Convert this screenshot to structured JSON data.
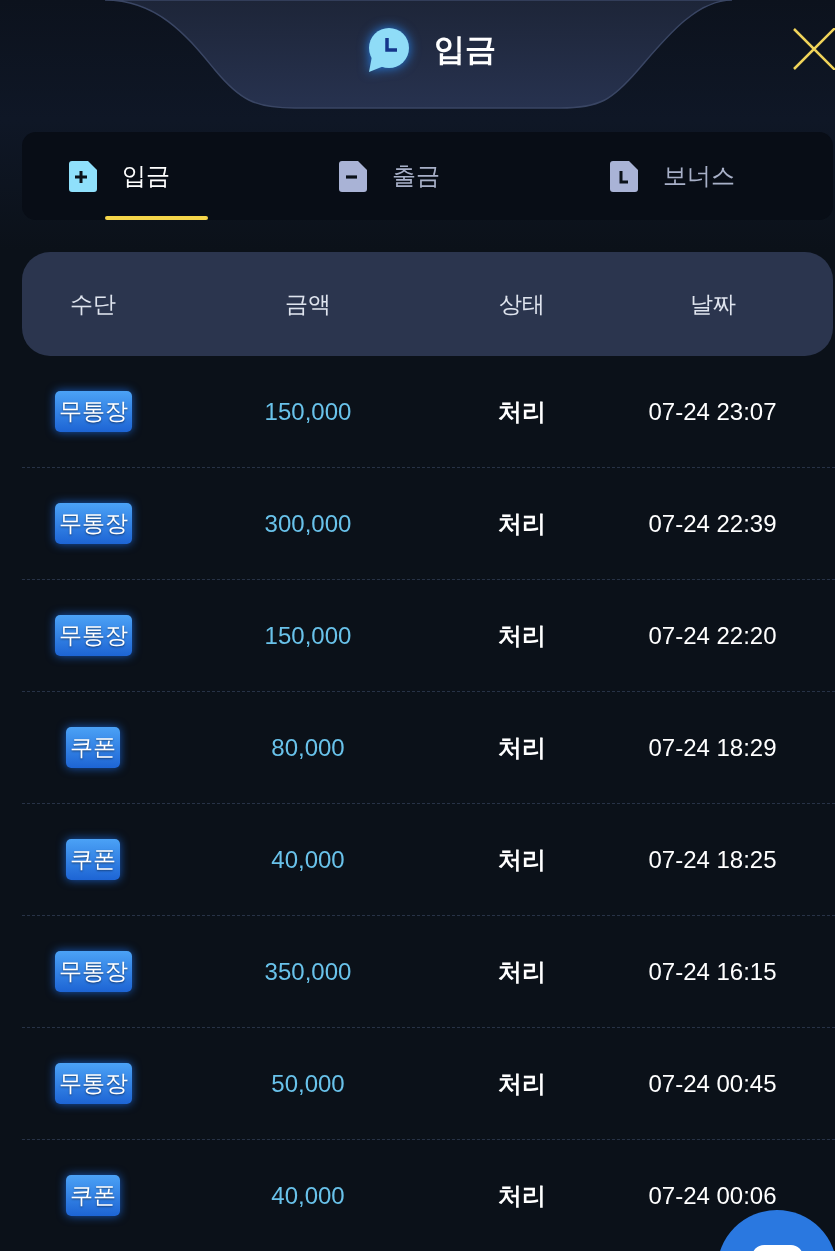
{
  "header": {
    "title": "입금"
  },
  "tabs": [
    {
      "label": "입금",
      "selected": true
    },
    {
      "label": "출금",
      "selected": false
    },
    {
      "label": "보너스",
      "selected": false
    }
  ],
  "table": {
    "columns": [
      "수단",
      "금액",
      "상태",
      "날짜"
    ],
    "rows": [
      {
        "method": "무통장",
        "amount": "150,000",
        "status": "처리",
        "date": "07-24 23:07"
      },
      {
        "method": "무통장",
        "amount": "300,000",
        "status": "처리",
        "date": "07-24 22:39"
      },
      {
        "method": "무통장",
        "amount": "150,000",
        "status": "처리",
        "date": "07-24 22:20"
      },
      {
        "method": "쿠폰",
        "amount": "80,000",
        "status": "처리",
        "date": "07-24 18:29"
      },
      {
        "method": "쿠폰",
        "amount": "40,000",
        "status": "처리",
        "date": "07-24 18:25"
      },
      {
        "method": "무통장",
        "amount": "350,000",
        "status": "처리",
        "date": "07-24 16:15"
      },
      {
        "method": "무통장",
        "amount": "50,000",
        "status": "처리",
        "date": "07-24 00:45"
      },
      {
        "method": "쿠폰",
        "amount": "40,000",
        "status": "처리",
        "date": "07-24 00:06"
      }
    ]
  }
}
